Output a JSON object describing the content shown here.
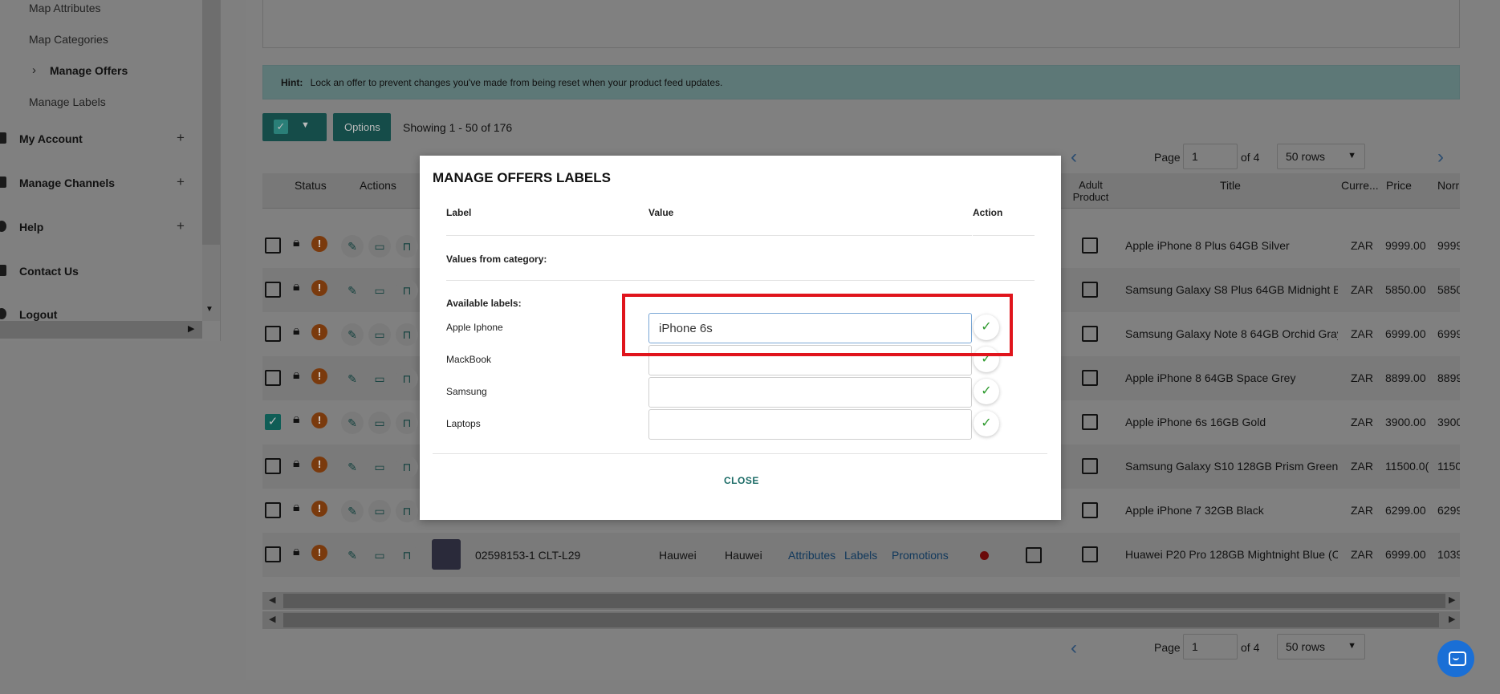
{
  "sidebar": {
    "sub_items": [
      "Map Attributes",
      "Map Categories",
      "Manage Offers",
      "Manage Labels"
    ],
    "active_sub": "Manage Offers",
    "main_items": [
      "My Account",
      "Manage Channels",
      "Help",
      "Contact Us",
      "Logout"
    ],
    "expand_symbol": "+"
  },
  "hint": {
    "prefix": "Hint:",
    "text": "Lock an offer to prevent changes you've made from being reset when your product feed updates."
  },
  "toolbar": {
    "options_label": "Options",
    "showing": "Showing 1 - 50 of 176"
  },
  "pagination": {
    "page_label": "Page",
    "page_value": "1",
    "of_label": "of 4",
    "rows_value": "50 rows"
  },
  "table": {
    "headers": {
      "status": "Status",
      "actions": "Actions",
      "adult_product": "Adult Product",
      "title": "Title",
      "currency": "Curre...",
      "price": "Price",
      "normal": "Norr"
    },
    "rows": [
      {
        "title": "Apple iPhone 8 Plus 64GB Silver",
        "currency": "ZAR",
        "price": "9999.00",
        "normal": "9999",
        "checked": false
      },
      {
        "title": "Samsung Galaxy S8 Plus 64GB Midnight Bl",
        "currency": "ZAR",
        "price": "5850.00",
        "normal": "5850",
        "checked": false
      },
      {
        "title": "Samsung Galaxy Note 8 64GB Orchid Gray",
        "currency": "ZAR",
        "price": "6999.00",
        "normal": "6999",
        "checked": false
      },
      {
        "title": "Apple iPhone 8 64GB Space Grey",
        "currency": "ZAR",
        "price": "8899.00",
        "normal": "8899",
        "checked": false
      },
      {
        "title": "Apple iPhone 6s 16GB Gold",
        "currency": "ZAR",
        "price": "3900.00",
        "normal": "3900",
        "checked": true
      },
      {
        "title": "Samsung Galaxy S10 128GB Prism Green",
        "currency": "ZAR",
        "price": "11500.0(",
        "normal": "1150",
        "checked": false
      },
      {
        "title": "Apple iPhone 7 32GB Black",
        "currency": "ZAR",
        "price": "6299.00",
        "normal": "6299",
        "checked": false
      },
      {
        "title": "Huawei P20 Pro 128GB Mightnight Blue (C",
        "currency": "ZAR",
        "price": "6999.00",
        "normal": "1039",
        "checked": false
      }
    ],
    "last_row_extra": {
      "sku": "02598153-1 CLT-L29",
      "brand": "Hauwei",
      "manufacturer": "Hauwei",
      "attributes": "Attributes",
      "labels": "Labels",
      "promotions": "Promotions"
    }
  },
  "modal": {
    "title": "MANAGE OFFERS LABELS",
    "headers": {
      "label": "Label",
      "value": "Value",
      "action": "Action"
    },
    "values_from_category": "Values from category:",
    "available_labels": "Available labels:",
    "labels": [
      {
        "name": "Apple Iphone",
        "value": "iPhone 6s"
      },
      {
        "name": "MackBook",
        "value": ""
      },
      {
        "name": "Samsung",
        "value": ""
      },
      {
        "name": "Laptops",
        "value": ""
      }
    ],
    "close_label": "CLOSE"
  },
  "colors": {
    "accent": "#1b6b66",
    "highlight_box": "#e0141c",
    "chat_button": "#1a6fd6"
  },
  "icons": [
    "chevron-right-icon",
    "plus-icon",
    "lock-icon",
    "warning-icon",
    "edit-icon",
    "laptop-icon",
    "check-icon",
    "chat-icon",
    "chevron-left-icon"
  ]
}
